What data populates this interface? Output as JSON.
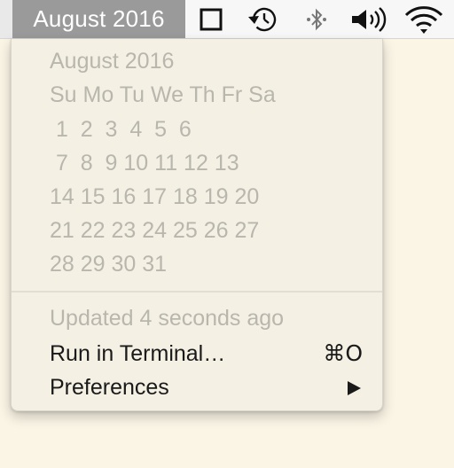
{
  "menubar": {
    "title": "August 2016",
    "status_icons": [
      "window-icon",
      "time-machine-icon",
      "bluetooth-icon",
      "volume-icon",
      "wifi-icon"
    ]
  },
  "calendar": {
    "month_title": "August 2016",
    "weekday_header": "Su Mo Tu We Th Fr Sa",
    "weeks": [
      " 1  2  3  4  5  6",
      " 7  8  9 10 11 12 13",
      "14 15 16 17 18 19 20",
      "21 22 23 24 25 26 27",
      "28 29 30 31"
    ]
  },
  "menu": {
    "updated_text": "Updated 4 seconds ago",
    "items": [
      {
        "label": "Run in Terminal…",
        "shortcut": "⌘O"
      },
      {
        "label": "Preferences",
        "submenu": true
      }
    ]
  },
  "colors": {
    "menubar_bg": "#f7f7f7",
    "title_highlight": "#9a9a9a",
    "menu_bg": "#f4f0e4",
    "disabled_text": "#b9b6ae",
    "enabled_text": "#1a1a1a",
    "desktop_bg": "#fbf5e6"
  }
}
